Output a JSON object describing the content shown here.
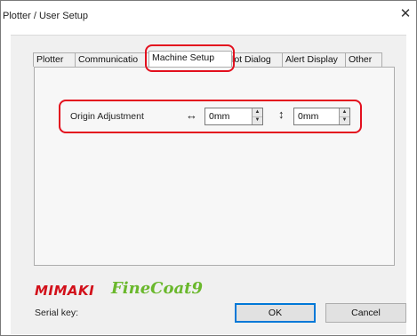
{
  "window": {
    "title": "Plotter / User Setup",
    "close_glyph": "✕"
  },
  "tabs": [
    {
      "label": "Plotter"
    },
    {
      "label": "Communicatio"
    },
    {
      "label": "Machine Setup"
    },
    {
      "label": "lot Dialog"
    },
    {
      "label": "Alert Display"
    },
    {
      "label": "Other"
    }
  ],
  "active_tab": "Machine Setup",
  "origin": {
    "label": "Origin Adjustment",
    "horizontal_icon": "↔",
    "horizontal_value": "0mm",
    "vertical_icon": "↕",
    "vertical_value": "0mm"
  },
  "spin_glyphs": {
    "up": "▲",
    "down": "▼"
  },
  "brand": {
    "mimaki": "MIMAKI",
    "product": "FineCoat9"
  },
  "footer": {
    "serial_label": "Serial key:",
    "ok_label": "OK",
    "cancel_label": "Cancel"
  },
  "colors": {
    "highlight": "#e3101e",
    "mimaki_red": "#d2101a",
    "finecoat_green": "#6ab82c",
    "default_button": "#0078d7"
  }
}
